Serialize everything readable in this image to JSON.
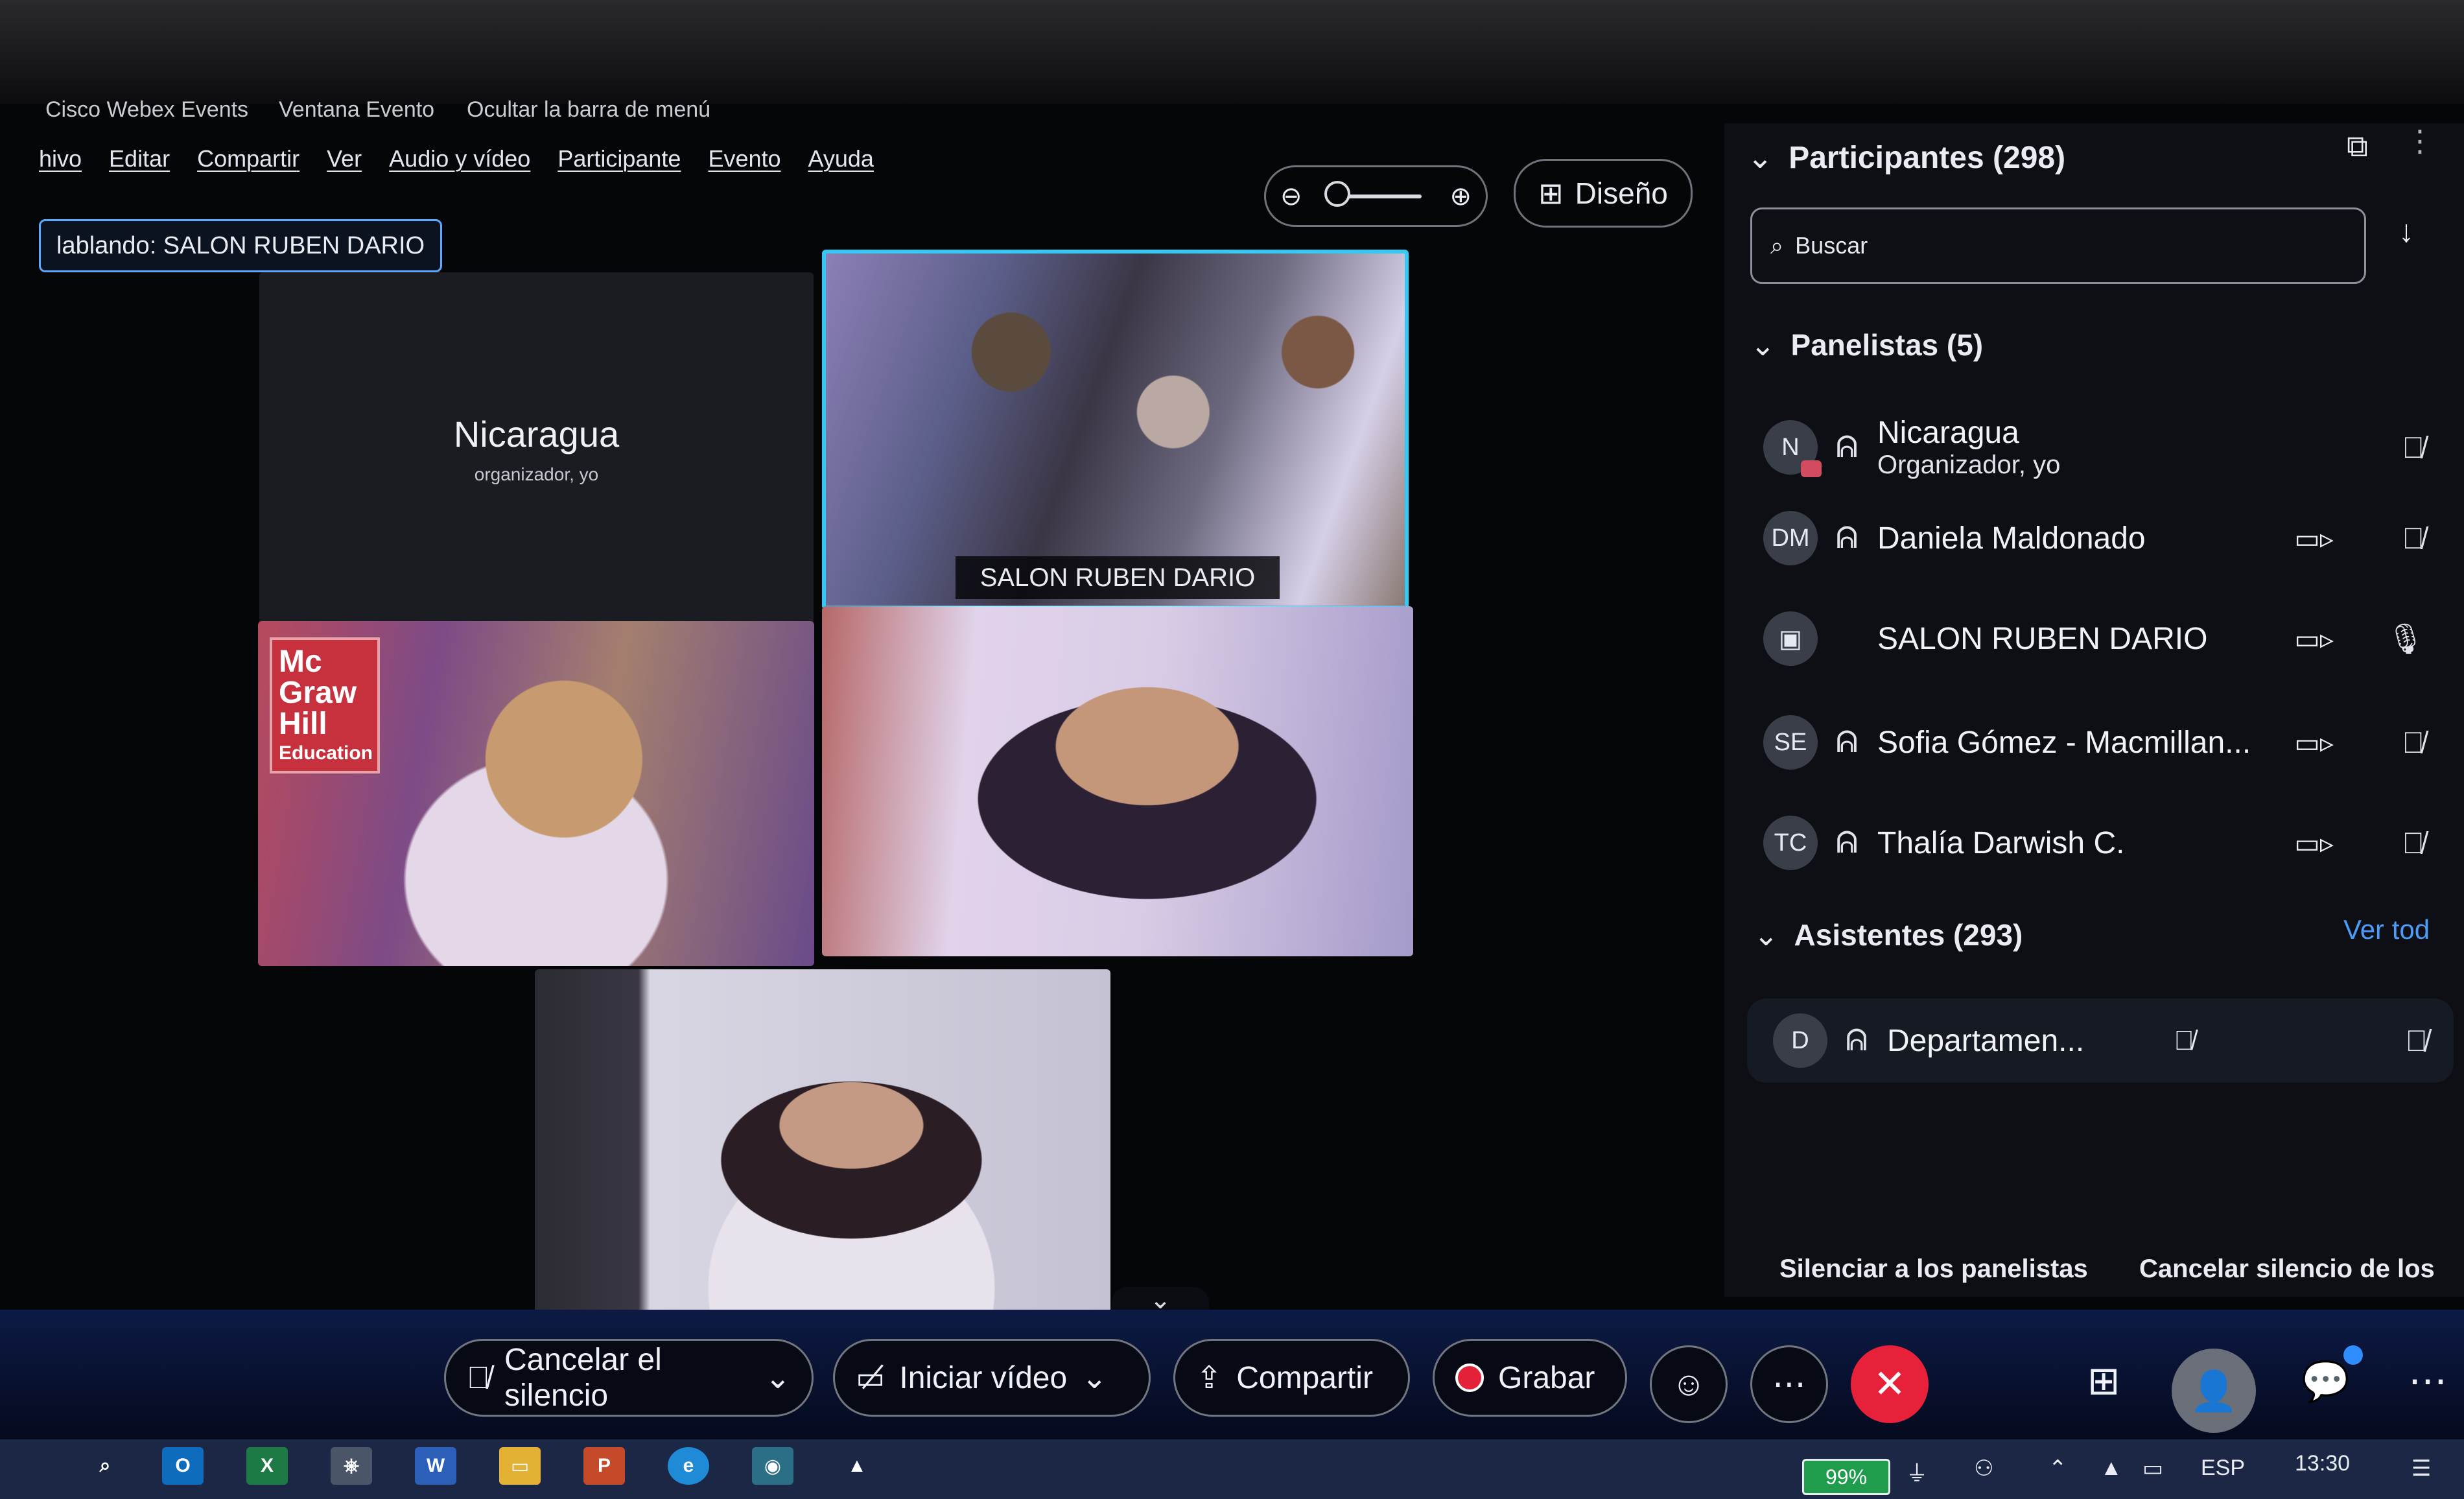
{
  "window": {
    "app_name": "Cisco Webex Events",
    "event_window": "Ventana Evento",
    "hide_menu": "Ocultar la barra de menú"
  },
  "menu": [
    "hivo",
    "Editar",
    "Compartir",
    "Ver",
    "Audio y vídeo",
    "Participante",
    "Evento",
    "Ayuda"
  ],
  "speaking": "lablando: SALON RUBEN DARIO",
  "layout_button": "Diseño",
  "tiles": {
    "nicaragua": {
      "name": "Nicaragua",
      "role": "organizador, yo"
    },
    "salon": {
      "label": "SALON RUBEN DARIO"
    },
    "mcgraw_logo": {
      "line1": "Mc",
      "line2": "Graw",
      "line3": "Hill",
      "line4": "Education"
    }
  },
  "panel": {
    "title": "Participantes (298)",
    "search_placeholder": "Buscar",
    "panelists_title": "Panelistas (5)",
    "panelists": [
      {
        "initials": "N",
        "name": "Nicaragua",
        "subtitle": "Organizador, yo"
      },
      {
        "initials": "DM",
        "name": "Daniela Maldonado"
      },
      {
        "initials": "",
        "name": "SALON RUBEN DARIO"
      },
      {
        "initials": "SE",
        "name": "Sofia Gómez - Macmillan..."
      },
      {
        "initials": "TC",
        "name": "Thalía Darwish C."
      }
    ],
    "attendees_title": "Asistentes (293)",
    "view_all": "Ver tod",
    "attendees": [
      {
        "initials": "D",
        "name": "Departamen..."
      }
    ],
    "mute_panelists": "Silenciar a los panelistas",
    "unmute": "Cancelar silencio de los"
  },
  "controls": {
    "unmute": "Cancelar el silencio",
    "start_video": "Iniciar vídeo",
    "share": "Compartir",
    "record": "Grabar"
  },
  "taskbar": {
    "battery": "99%",
    "lang": "ESP",
    "time": "13:30"
  }
}
